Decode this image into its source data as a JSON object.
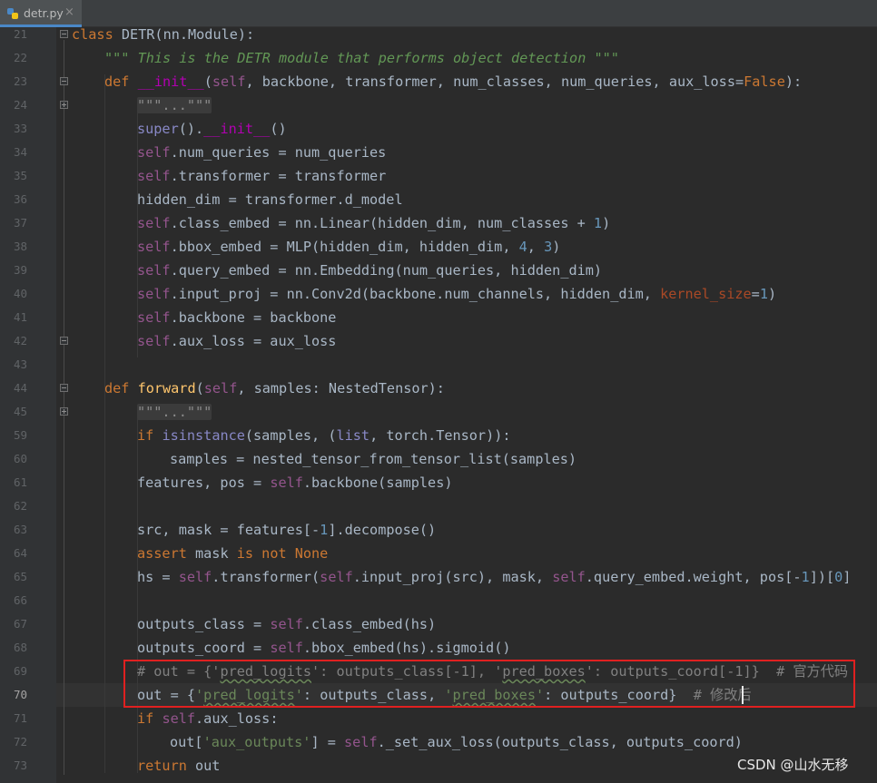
{
  "tab": {
    "filename": "detr.py",
    "close": "×",
    "icon": "python-file-icon"
  },
  "colors": {
    "keyword": "#cc7832",
    "self": "#94558d",
    "string": "#6a8759",
    "number": "#6897bb",
    "comment": "#808080",
    "function": "#ffc66d",
    "highlight_box": "#e02020"
  },
  "code": {
    "l21": {
      "num": "21",
      "a": "class",
      "b": " DETR(nn.Module):"
    },
    "l22": {
      "num": "22",
      "a": "\"\"\" This is the DETR module that performs object detection \"\"\""
    },
    "l23": {
      "num": "23",
      "a": "def",
      "b": "__init__",
      "c": "(",
      "d": "self",
      "e": ", backbone, transformer, num_classes, num_queries, ",
      "f": "aux_loss",
      "g": "=",
      "h": "False",
      "i": "):"
    },
    "l24": {
      "num": "24",
      "a": "\"\"\"...\"\"\""
    },
    "l33": {
      "num": "33",
      "a": "super",
      "b": "().",
      "c": "__init__",
      "d": "()"
    },
    "l34": {
      "num": "34",
      "a": "self",
      "b": ".num_queries = num_queries"
    },
    "l35": {
      "num": "35",
      "a": "self",
      "b": ".transformer = transformer"
    },
    "l36": {
      "num": "36",
      "a": "hidden_dim = transformer.d_model"
    },
    "l37": {
      "num": "37",
      "a": "self",
      "b": ".class_embed = nn.Linear(hidden_dim, num_classes + ",
      "c": "1",
      "d": ")"
    },
    "l38": {
      "num": "38",
      "a": "self",
      "b": ".bbox_embed = MLP(hidden_dim, hidden_dim, ",
      "c": "4",
      "d": ", ",
      "e": "3",
      "f": ")"
    },
    "l39": {
      "num": "39",
      "a": "self",
      "b": ".query_embed = nn.Embedding(num_queries, hidden_dim)"
    },
    "l40": {
      "num": "40",
      "a": "self",
      "b": ".input_proj = nn.Conv2d(backbone.num_channels, hidden_dim, ",
      "c": "kernel_size",
      "d": "=",
      "e": "1",
      "f": ")"
    },
    "l41": {
      "num": "41",
      "a": "self",
      "b": ".backbone = backbone"
    },
    "l42": {
      "num": "42",
      "a": "self",
      "b": ".aux_loss = aux_loss"
    },
    "l43": {
      "num": "43"
    },
    "l44": {
      "num": "44",
      "a": "def",
      "b": "forward",
      "c": "(",
      "d": "self",
      "e": ", samples: NestedTensor):"
    },
    "l45": {
      "num": "45",
      "a": "\"\"\"...\"\"\""
    },
    "l59": {
      "num": "59",
      "a": "if",
      "b": "isinstance",
      "c": "(samples, (",
      "d": "list",
      "e": ", torch.Tensor)):"
    },
    "l60": {
      "num": "60",
      "a": "samples = nested_tensor_from_tensor_list(samples)"
    },
    "l61": {
      "num": "61",
      "a": "features, pos = ",
      "b": "self",
      "c": ".backbone(samples)"
    },
    "l62": {
      "num": "62"
    },
    "l63": {
      "num": "63",
      "a": "src, mask = features[-",
      "b": "1",
      "c": "].decompose()"
    },
    "l64": {
      "num": "64",
      "a": "assert",
      "b": " mask ",
      "c": "is not None"
    },
    "l65": {
      "num": "65",
      "a": "hs = ",
      "b": "self",
      "c": ".transformer(",
      "d": "self",
      "e": ".input_proj(src), mask, ",
      "f": "self",
      "g": ".query_embed.weight, pos[-",
      "h": "1",
      "i": "])[",
      "j": "0",
      "k": "]"
    },
    "l66": {
      "num": "66"
    },
    "l67": {
      "num": "67",
      "a": "outputs_class = ",
      "b": "self",
      "c": ".class_embed(hs)"
    },
    "l68": {
      "num": "68",
      "a": "outputs_coord = ",
      "b": "self",
      "c": ".bbox_embed(hs).sigmoid()"
    },
    "l69": {
      "num": "69",
      "a": "# out = {'",
      "b": "pred_logits",
      "c": "': outputs_class[-1], '",
      "d": "pred_boxes",
      "e": "': outputs_coord[-1]}  # 官方代码"
    },
    "l70": {
      "num": "70",
      "a": "out = {",
      "b": "'",
      "c": "pred_logits",
      "d": "'",
      "e": ": outputs_class, ",
      "f": "'",
      "g": "pred_boxes",
      "h": "'",
      "i": ": outputs_coord}  ",
      "j": "# 修改后"
    },
    "l71": {
      "num": "71",
      "a": "if",
      "b": "self",
      "c": ".aux_loss:"
    },
    "l72": {
      "num": "72",
      "a": "out[",
      "b": "'aux_outputs'",
      "c": "] = ",
      "d": "self",
      "e": "._set_aux_loss(outputs_class, outputs_coord)"
    },
    "l73": {
      "num": "73",
      "a": "return",
      "b": " out"
    }
  },
  "watermark": "CSDN @山水无移"
}
